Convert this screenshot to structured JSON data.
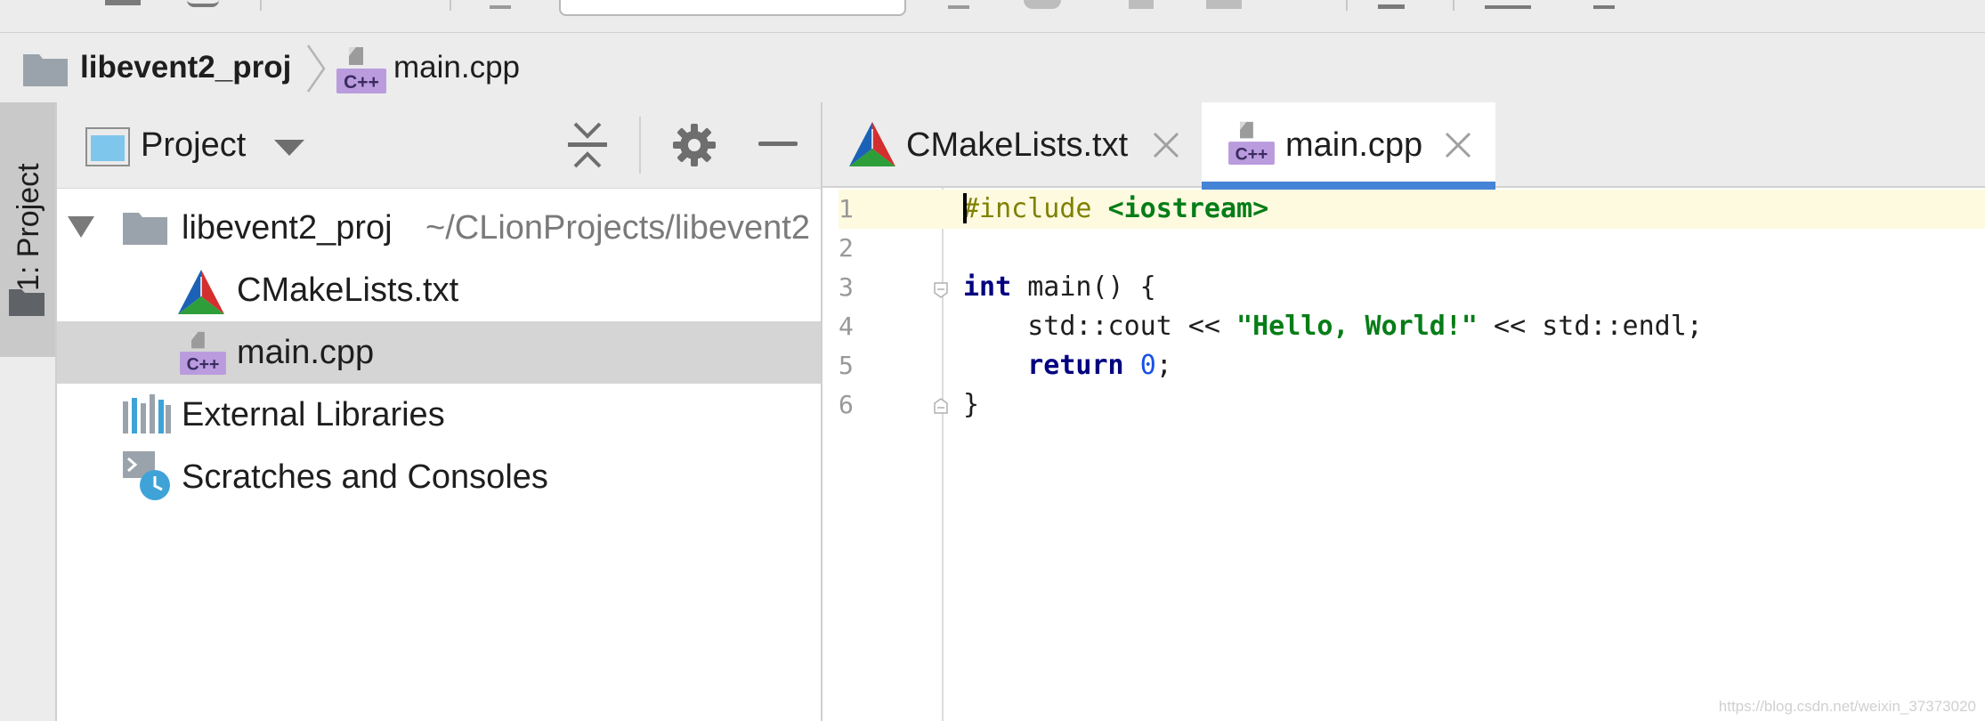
{
  "breadcrumb": {
    "project": "libevent2_proj",
    "file": "main.cpp"
  },
  "left_stripe": {
    "tab_label": "1: Project"
  },
  "project_panel": {
    "title": "Project",
    "tree": [
      {
        "label": "libevent2_proj",
        "hint": "~/CLionProjects/libevent2",
        "icon": "folder-icon"
      },
      {
        "label": "CMakeLists.txt",
        "icon": "cmake-icon"
      },
      {
        "label": "main.cpp",
        "icon": "cpp-file-icon",
        "selected": true
      },
      {
        "label": "External Libraries",
        "icon": "libraries-icon"
      },
      {
        "label": "Scratches and Consoles",
        "icon": "scratches-icon"
      }
    ]
  },
  "editor": {
    "tabs": [
      {
        "label": "CMakeLists.txt",
        "icon": "cmake-icon",
        "active": false
      },
      {
        "label": "main.cpp",
        "icon": "cpp-file-icon",
        "active": true
      }
    ],
    "line_numbers": [
      "1",
      "2",
      "3",
      "4",
      "5",
      "6"
    ],
    "code": {
      "l1_directive": "#include",
      "l1_header": "<iostream>",
      "l3_type": "int",
      "l3_rest": " main() {",
      "l4_pre": "    std::cout << ",
      "l4_str": "\"Hello, World!\"",
      "l4_post": " << std::endl;",
      "l5_kw": "return",
      "l5_num": "0",
      "l5_end": ";",
      "l6": "}"
    }
  },
  "watermark": "https://blog.csdn.net/weixin_37373020",
  "colors": {
    "selection": "#d5d5d5",
    "active_tab_underline": "#4583d6",
    "current_line": "#fdfae0",
    "keyword": "#000080",
    "string": "#067d17",
    "preprocessor": "#808000",
    "number": "#1750eb"
  }
}
